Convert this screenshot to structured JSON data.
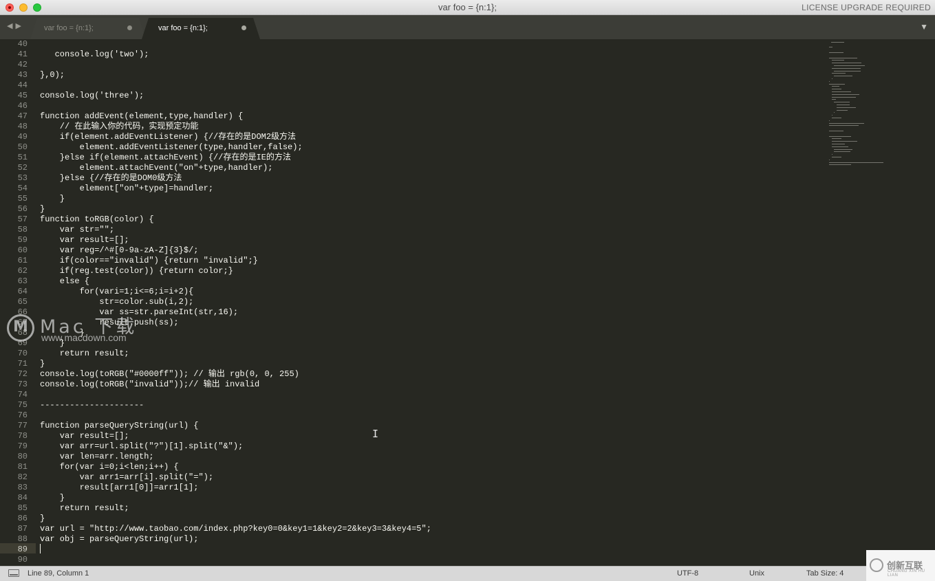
{
  "window": {
    "title": "var foo = {n:1};",
    "license_notice": "LICENSE UPGRADE REQUIRED"
  },
  "tabs": [
    {
      "label": "var foo = {n:1};",
      "active": false,
      "modified": true
    },
    {
      "label": "var foo = {n:1};",
      "active": true,
      "modified": true
    }
  ],
  "editor": {
    "first_line_number": 40,
    "current_line": 89,
    "lines": [
      "",
      "   console.log('two');",
      "",
      "},0);",
      "",
      "console.log('three');",
      "",
      "function addEvent(element,type,handler) {",
      "    // 在此输入你的代码，实现预定功能",
      "    if(element.addEventListener) {//存在的是DOM2级方法",
      "        element.addEventListener(type,handler,false);",
      "    }else if(element.attachEvent) {//存在的是IE的方法",
      "        element.attachEvent(\"on\"+type,handler);",
      "    }else {//存在的是DOM0级方法",
      "        element[\"on\"+type]=handler;",
      "    }",
      "}",
      "function toRGB(color) {",
      "    var str=\"\";",
      "    var result=[];",
      "    var reg=/^#[0-9a-zA-Z]{3}$/;",
      "    if(color==\"invalid\") {return \"invalid\";}",
      "    if(reg.test(color)) {return color;}",
      "    else {",
      "        for(vari=1;i<=6;i=i+2){",
      "            str=color.sub(i,2);",
      "            var ss=str.parseInt(str,16);",
      "            result.push(ss);",
      "        }",
      "    }",
      "    return result;",
      "}",
      "console.log(toRGB(\"#0000ff\")); // 输出 rgb(0, 0, 255)",
      "console.log(toRGB(\"invalid\"));// 输出 invalid",
      "",
      "---------------------",
      "",
      "function parseQueryString(url) {",
      "    var result=[];",
      "    var arr=url.split(\"?\")[1].split(\"&\");",
      "    var len=arr.length;",
      "    for(var i=0;i<len;i++) {",
      "        var arr1=arr[i].split(\"=\");",
      "        result[arr1[0]]=arr1[1];",
      "    }",
      "    return result;",
      "}",
      "var url = \"http://www.taobao.com/index.php?key0=0&key1=1&key2=2&key3=3&key4=5\";",
      "var obj = parseQueryString(url);",
      "",
      ""
    ]
  },
  "watermark": {
    "brand": "Mac 下载",
    "url": "www.macdown.com"
  },
  "statusbar": {
    "position": "Line 89, Column 1",
    "encoding": "UTF-8",
    "line_endings": "Unix",
    "tab_size": "Tab Size: 4"
  },
  "corner_logo": {
    "name": "创新互联",
    "sub": "CHUANG XIN HU LIAN"
  },
  "colors": {
    "editor_bg": "#272822",
    "tabbar_bg": "#3c3d37",
    "text": "#f8f8f2",
    "gutter_text": "#8f908a",
    "statusbar_bg": "#d8d8d8"
  }
}
